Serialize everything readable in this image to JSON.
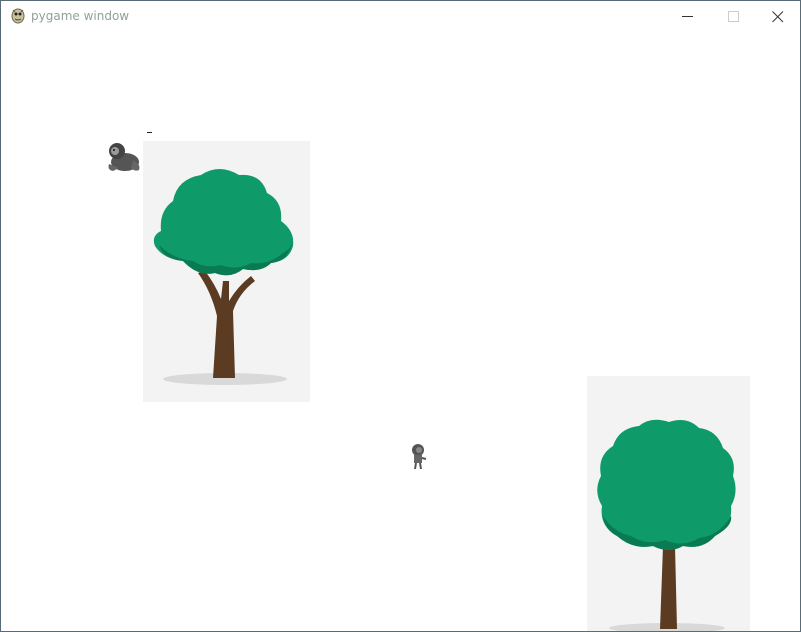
{
  "window": {
    "title": "pygame window",
    "icon": "pygame-snake-icon",
    "controls": {
      "minimize_icon": "minimize-icon",
      "maximize_icon": "maximize-icon",
      "close_icon": "close-icon"
    }
  },
  "game": {
    "background_color": "#ffffff",
    "objects": [
      {
        "name": "tree",
        "icon": "tree-icon",
        "foliage_color": "#0f9a6a",
        "trunk_color": "#5b3b22"
      },
      {
        "name": "tree",
        "icon": "tree-icon",
        "foliage_color": "#0f9a6a",
        "trunk_color": "#5b3b22"
      },
      {
        "name": "monkey",
        "icon": "monkey-sprite-icon"
      },
      {
        "name": "player",
        "icon": "player-sprite-icon"
      }
    ]
  }
}
